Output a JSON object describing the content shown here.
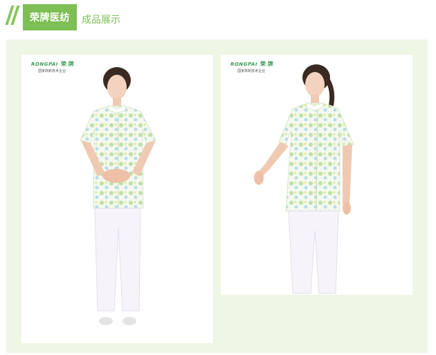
{
  "header": {
    "badge_label": "荣牌医纺",
    "subtitle": "成品展示"
  },
  "cards": [
    {
      "brand_en": "RONGPAI",
      "brand_cn": "荣 牌",
      "brand_tag": "国家高新技术企业"
    },
    {
      "brand_en": "RONGPAI",
      "brand_cn": "荣 牌",
      "brand_tag": "国家高新技术企业"
    }
  ],
  "colors": {
    "accent": "#7dbe55",
    "panel_bg": "#eef6e4",
    "brand_green": "#3c9a52"
  }
}
